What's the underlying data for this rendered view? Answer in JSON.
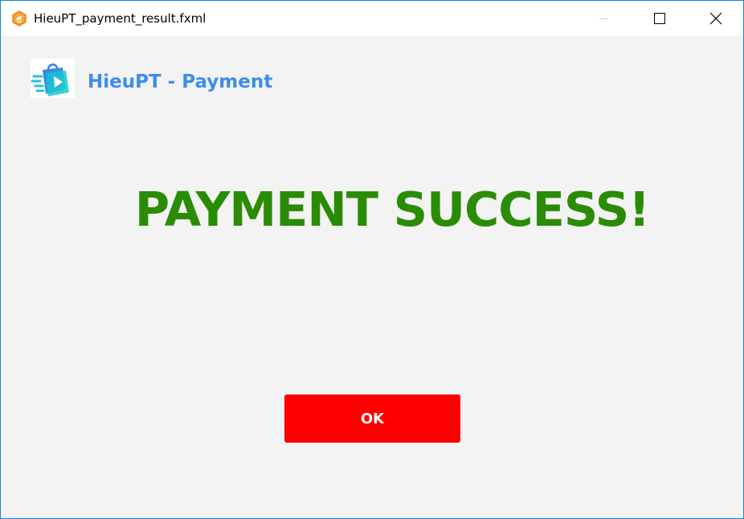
{
  "window": {
    "title": "HieuPT_payment_result.fxml"
  },
  "header": {
    "brand_title": "HieuPT - Payment",
    "logo_icon": "shopping-bag-play-icon"
  },
  "main": {
    "result_message": "PAYMENT SUCCESS!",
    "ok_label": "OK"
  },
  "colors": {
    "brand_blue": "#3d8de8",
    "success_green": "#2a8c04",
    "ok_button_red": "#ff0000",
    "window_border": "#1883d7",
    "background": "#f3f3f3"
  }
}
